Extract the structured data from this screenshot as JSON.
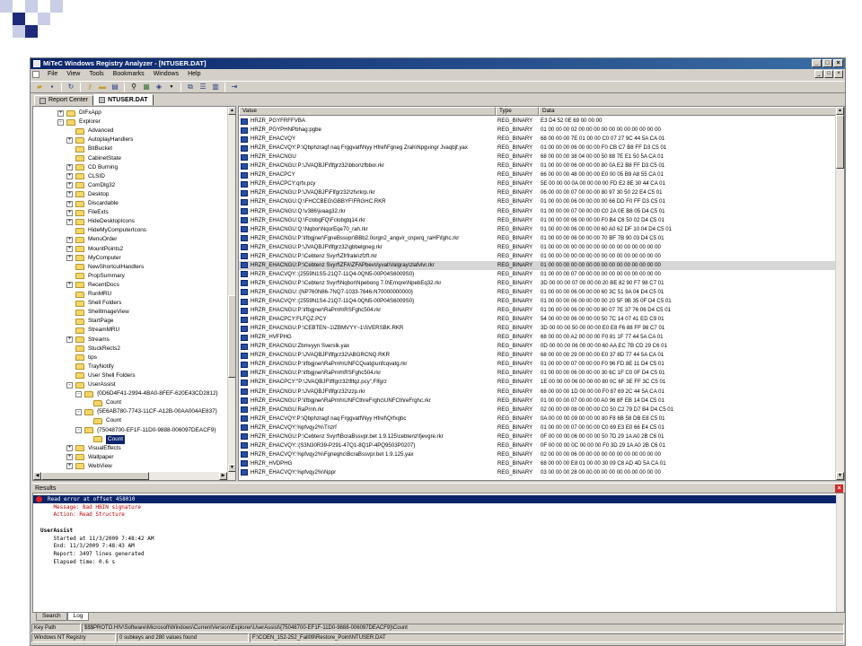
{
  "window": {
    "title": "MiTeC Windows Registry Analyzer - [NTUSER.DAT]",
    "controls": [
      "_",
      "□",
      "×"
    ],
    "mdi_controls": [
      "_",
      "□",
      "×"
    ]
  },
  "menu": [
    "File",
    "View",
    "Tools",
    "Bookmarks",
    "Windows",
    "Help"
  ],
  "tabs": [
    {
      "label": "Report Center",
      "active": false
    },
    {
      "label": "NTUSER.DAT",
      "active": true
    }
  ],
  "tree": [
    {
      "label": "DIFxApp",
      "depth": 4,
      "expand": "+"
    },
    {
      "label": "Explorer",
      "depth": 4,
      "expand": "-"
    },
    {
      "label": "Advanced",
      "depth": 5,
      "expand": ""
    },
    {
      "label": "AutoplayHandlers",
      "depth": 5,
      "expand": "+"
    },
    {
      "label": "BitBucket",
      "depth": 5,
      "expand": ""
    },
    {
      "label": "CabinetState",
      "depth": 5,
      "expand": ""
    },
    {
      "label": "CD Burning",
      "depth": 5,
      "expand": "+"
    },
    {
      "label": "CLSID",
      "depth": 5,
      "expand": "+"
    },
    {
      "label": "ComDlg32",
      "depth": 5,
      "expand": "+"
    },
    {
      "label": "Desktop",
      "depth": 5,
      "expand": "+"
    },
    {
      "label": "Discardable",
      "depth": 5,
      "expand": "+"
    },
    {
      "label": "FileExts",
      "depth": 5,
      "expand": "+"
    },
    {
      "label": "HideDesktopIcons",
      "depth": 5,
      "expand": "+"
    },
    {
      "label": "HideMyComputerIcons",
      "depth": 5,
      "expand": ""
    },
    {
      "label": "MenuOrder",
      "depth": 5,
      "expand": "+"
    },
    {
      "label": "MountPoints2",
      "depth": 5,
      "expand": "+"
    },
    {
      "label": "MyComputer",
      "depth": 5,
      "expand": "+"
    },
    {
      "label": "NewShortcutHandlers",
      "depth": 5,
      "expand": ""
    },
    {
      "label": "PropSummary",
      "depth": 5,
      "expand": ""
    },
    {
      "label": "RecentDocs",
      "depth": 5,
      "expand": "+"
    },
    {
      "label": "RunMRU",
      "depth": 5,
      "expand": ""
    },
    {
      "label": "Shell Folders",
      "depth": 5,
      "expand": ""
    },
    {
      "label": "ShellImageView",
      "depth": 5,
      "expand": ""
    },
    {
      "label": "StartPage",
      "depth": 5,
      "expand": ""
    },
    {
      "label": "StreamMRU",
      "depth": 5,
      "expand": ""
    },
    {
      "label": "Streams",
      "depth": 5,
      "expand": "+"
    },
    {
      "label": "StuckRects2",
      "depth": 5,
      "expand": ""
    },
    {
      "label": "tips",
      "depth": 5,
      "expand": ""
    },
    {
      "label": "TrayNotify",
      "depth": 5,
      "expand": ""
    },
    {
      "label": "User Shell Folders",
      "depth": 5,
      "expand": ""
    },
    {
      "label": "UserAssist",
      "depth": 5,
      "expand": "-"
    },
    {
      "label": "{0D6D4F41-2994-4BA0-8FEF-620E43CD2812}",
      "depth": 6,
      "expand": "-"
    },
    {
      "label": "Count",
      "depth": 7,
      "expand": ""
    },
    {
      "label": "{5E6AB780-7743-11CF-A12B-00AA004AE837}",
      "depth": 6,
      "expand": "-"
    },
    {
      "label": "Count",
      "depth": 7,
      "expand": ""
    },
    {
      "label": "{75048700-EF1F-11D0-9888-006097DEACF9}",
      "depth": 6,
      "expand": "-"
    },
    {
      "label": "Count",
      "depth": 7,
      "expand": "",
      "selected": true
    },
    {
      "label": "VisualEffects",
      "depth": 5,
      "expand": "+"
    },
    {
      "label": "Wallpaper",
      "depth": 5,
      "expand": "+"
    },
    {
      "label": "WebView",
      "depth": 5,
      "expand": "+"
    }
  ],
  "values_header": {
    "value": "Value",
    "type": "Type",
    "data": "Data"
  },
  "values": [
    {
      "name": "HRZR_PGYFRFFVBA",
      "type": "REG_BINARY",
      "data": "E3 D4 52 0E 69 00 00 00"
    },
    {
      "name": "HRZR_PGYPHNPbhag:pgbe",
      "type": "REG_BINARY",
      "data": "01 00 00 00 02 00 00 00 00 00 00 00 00 00 00 00"
    },
    {
      "name": "HRZR_EHACVQY",
      "type": "REG_BINARY",
      "data": "68 00 00 00 7E 01 00 00 C0 07 27 9C 44 5A CA 01"
    },
    {
      "name": "HRZR_EHACVQY:P:\\Qbphzragf naq Frggvatf\\Nyy Hfref\\Fgneg Zrah\\Npgvingr Jvaqbjf.yax",
      "type": "REG_BINARY",
      "data": "01 00 00 00 06 00 00 00 F0 CB C7 B8 FF D3 C5 01"
    },
    {
      "name": "HRZR_EHACNGU",
      "type": "REG_BINARY",
      "data": "68 00 00 00 38 04 00 00 50 88 7E E1 50 5A CA 01"
    },
    {
      "name": "HRZR_EHACNGU:P:\\JVAQBJF\\flfgrz32\\bbor\\zfbbor.rkr",
      "type": "REG_BINARY",
      "data": "01 00 00 00 06 00 00 00 80 0A E2 B8 FF D3 C5 01"
    },
    {
      "name": "HRZR_EHACPCY",
      "type": "REG_BINARY",
      "data": "66 00 00 00 48 00 00 00 E0 00 05 B9 A8 55 CA 01"
    },
    {
      "name": "HRZR_EHACPCY:qrfx.pcy",
      "type": "REG_BINARY",
      "data": "5E 00 00 00 0A 00 00 00 00 FD E2 8E 30 44 CA 01"
    },
    {
      "name": "HRZR_EHACNGU:P:\\JVAQBJF\\Flfgrz32\\zfvrkrp.rkr",
      "type": "REG_BINARY",
      "data": "06 00 00 00 07 00 00 00 80 97 30 50 22 E4 C5 01"
    },
    {
      "name": "HRZR_EHACNGU:Q:\\FHCCBEG\\GBBYF\\FRGHC.RKR",
      "type": "REG_BINARY",
      "data": "01 00 00 00 06 00 00 00 00 66 DD F0 FF D3 C5 01"
    },
    {
      "name": "HRZR_EHACNGU:Q:\\v386\\jvaag32.rkr",
      "type": "REG_BINARY",
      "data": "01 00 00 00 07 00 00 00 C0 2A 0E B8 05 D4 C5 01"
    },
    {
      "name": "HRZR_EHACNGU:Q:\\FclobgFQ\\Fclobgtq14.rkr",
      "type": "REG_BINARY",
      "data": "01 00 00 00 06 00 00 00 F0 B4 C6 50 02 D4 C5 01"
    },
    {
      "name": "HRZR_EHACNGU:Q:\\Nqbor\\NqorEqe70_rah.rkr",
      "type": "REG_BINARY",
      "data": "01 00 00 00 06 00 00 00 60 A0 62 DF 10 04 D4 C5 01"
    },
    {
      "name": "HRZR_EHACNGU:P:\\Ifbgjner\\FgneBssvpr\\BBb2.0orgn2_angvir_cnpxrq_raHF\\fghc.rkr",
      "type": "REG_BINARY",
      "data": "01 00 00 00 06 00 00 00 70 BF 7B 90 03 D4 C5 01"
    },
    {
      "name": "HRZR_EHACNGU:P:\\JVAQBJF\\flfgrz32\\gbbelgneg.rkr",
      "type": "REG_BINARY",
      "data": "01 00 00 00 00 00 00 00 00 00 00 00 00 00 00 00"
    },
    {
      "name": "HRZR_EHACNGU:P:\\Cebtenz Svyrf\\Zfrfrate\\zfzft.rkr",
      "type": "REG_BINARY",
      "data": "01 00 00 00 00 00 00 00 00 00 00 00 00 00 00 00"
    },
    {
      "name": "HRZR_EHACNGU:P:\\Cebtenz Svyrf\\ZFA\\ZFAPbevs\\yvat\\Valgray\\zlafvlvr.rkr",
      "type": "REG_BINARY",
      "data": "01 00 00 00 00 00 00 00 00 00 00 00 00 00 00 00",
      "selected": true
    },
    {
      "name": "HRZR_EHACVQY::{2559N1S5-21Q7-11Q4-0QN5-00P04S6009S0}",
      "type": "REG_BINARY",
      "data": "01 00 00 00 07 00 00 00 00 00 00 00 00 00 00 00"
    },
    {
      "name": "HRZR_EHACNGU:P:\\Cebtenz Svyrf\\Nqbor\\Npebong 7.0\\Ernqre\\NpebEq32.rkr",
      "type": "REG_BINARY",
      "data": "3D 00 00 00 07 00 00 00 20 BE 82 90 F7 98 C7 01"
    },
    {
      "name": "HRZR_EHACNGU::{NP760N86-7NQ7-1033-7646-N70000000000}",
      "type": "REG_BINARY",
      "data": "01 00 00 00 06 00 00 00 60 3C 51 9A 04 D4 C5 01"
    },
    {
      "name": "HRZR_EHACVQY::{2559N1S4-21Q7-11Q4-0QN5-00P04S6009S0}",
      "type": "REG_BINARY",
      "data": "01 00 00 00 06 00 00 00 00 20 5F 9B 35 0F D4 C5 01"
    },
    {
      "name": "HRZR_EHACNGU:P:\\Ifbgjner\\RaPrnh\\RSFghc504.rkr",
      "type": "REG_BINARY",
      "data": "01 00 00 00 06 00 00 00 80 07 7E 37 76 06 D4 C5 01"
    },
    {
      "name": "HRZR_EHACPCY:FLFQZ.PCY",
      "type": "REG_BINARY",
      "data": "54 00 00 00 06 00 00 00 50 7C 14 07 41 ED C9 01"
    },
    {
      "name": "HRZR_EHACNGU:P:\\CEBTEN~1\\ZBMVYY~1\\SVERSBK.RKR",
      "type": "REG_BINARY",
      "data": "3D 00 00 00 50 00 00 00 E0 E8 F6 88 FF 98 C7 01"
    },
    {
      "name": "HRZR_HVFPHG",
      "type": "REG_BINARY",
      "data": "68 00 00 00 A2 00 00 00 F0 81 1F 77 44 5A CA 01"
    },
    {
      "name": "HRZR_EHACNGU:Zbmvyyn Sverslk.yax",
      "type": "REG_BINARY",
      "data": "0D 00 00 00 06 00 00 00 60 AA EC 7B CD 29 C6 01"
    },
    {
      "name": "HRZR_EHACNGU:P:\\JVAQBJF\\flfgrz32\\ABGRCNQ.RKR",
      "type": "REG_BINARY",
      "data": "68 00 00 00 29 00 00 00 E0 37 8D 77 44 5A CA 01"
    },
    {
      "name": "HRZR_EHACNGU:P:\\Ifbgjner\\RaPrnh\\UNFCQvatg\\unfcqvatg.rkr",
      "type": "REG_BINARY",
      "data": "01 00 00 00 07 00 00 00 F0 96 FD 8E 11 D4 C5 01"
    },
    {
      "name": "HRZR_EHACNGU:P:\\Ifbgjner\\RaPrnh\\RSFghc504.rkr",
      "type": "REG_BINARY",
      "data": "01 00 00 00 06 00 00 00 30 6C 1F C0 0F D4 C5 01"
    },
    {
      "name": "HRZR_EHACPCY:\"P:\\JVAQBJF\\flfgrz32\\flfqz.pcy\",Flfgrz",
      "type": "REG_BINARY",
      "data": "1E 00 00 00 06 00 00 00 80 0C 6F 3E FF 3C C5 01"
    },
    {
      "name": "HRZR_EHACNGU:P:\\JVAQBJF\\flfgrz32\\zzp.rkr",
      "type": "REG_BINARY",
      "data": "68 00 00 00 1D 00 00 00 F0 87 69 2C 44 5A CA 01"
    },
    {
      "name": "HRZR_EHACNGU:P:\\Ifbgjner\\RaPrnh\\UNFCthreFrghc\\UNFCthreFrghc.rkr",
      "type": "REG_BINARY",
      "data": "01 00 00 00 07 00 00 00 A0 96 8F EB 14 D4 C5 01"
    },
    {
      "name": "HRZR_EHACNGU:RaPrnh.rkr",
      "type": "REG_BINARY",
      "data": "02 00 00 00 08 00 00 00 C0 50 C2 79 D7 B4 D4 C5 01"
    },
    {
      "name": "HRZR_EHACVQY:P:\\Qbphzragf naq Frggvatf\\Nyy Hfref\\Qrfxgbc",
      "type": "REG_BINARY",
      "data": "0A 00 00 00 09 00 00 00 80 F8 6B 58 DB E8 C5 01"
    },
    {
      "name": "HRZR_EHACVQY:%pfvqy2%\\Tnzrf",
      "type": "REG_BINARY",
      "data": "01 00 00 00 07 00 00 00 C0 69 E3 E0 66 E4 C5 01"
    },
    {
      "name": "HRZR_EHACNGU:P:\\Cebtenz Svyrf\\BcraBssvpr.bet 1.9.125\\cebtenz\\fjevgre.rkr",
      "type": "REG_BINARY",
      "data": "0F 00 00 00 06 00 00 00 50 7D 29 1A A0 2B C6 01"
    },
    {
      "name": "HRZR_EHACVQY::{S3N30R39-P291-47Q1-8Q1P-4PQ9503P0207}",
      "type": "REG_BINARY",
      "data": "0F 00 00 00 0C 00 00 00 F0 3D 29 1A A0 2B C6 01"
    },
    {
      "name": "HRZR_EHACVQY:%pfvqy2%\\Fgneghc\\BcraBssvpr.bet 1.9.125.yax",
      "type": "REG_BINARY",
      "data": "02 00 00 00 06 00 00 00 00 00 00 00 00 00 00 00"
    },
    {
      "name": "HRZR_HVDPHG",
      "type": "REG_BINARY",
      "data": "68 00 00 00 E8 01 00 00 30 09 C8 AD 4D 5A CA 01"
    },
    {
      "name": "HRZR_EHACVQY:%pfvqy2%\\Nppr",
      "type": "REG_BINARY",
      "data": "03 00 00 00 28 00 00 00 00 00 00 00 00 00 00 00"
    }
  ],
  "results": {
    "header": "Results",
    "lines": [
      {
        "text": "Read error at offset 458010",
        "style": "err"
      },
      {
        "text": "    Message: Bad HBIN signature",
        "style": "red"
      },
      {
        "text": "    Action: Read Structure",
        "style": "red"
      },
      {
        "text": "",
        "style": ""
      },
      {
        "text": "UserAssist",
        "style": "bold"
      },
      {
        "text": "    Started at 11/3/2009 7:48:42 AM",
        "style": ""
      },
      {
        "text": "    End: 11/3/2009 7:48:43 AM",
        "style": ""
      },
      {
        "text": "    Report: 3497 lines generated",
        "style": ""
      },
      {
        "text": "    Elapsed time: 0.6 s",
        "style": ""
      }
    ]
  },
  "bottom_tabs": [
    {
      "label": "Search",
      "active": false
    },
    {
      "label": "Log",
      "active": true
    }
  ],
  "status": {
    "key_path_label": "Key Path",
    "key_path_value": "$$$PROTO.HIV\\Software\\Microsoft\\Windows\\CurrentVersion\\Explorer\\UserAssist\\{75048700-EF1F-11D0-9888-006097DEACF9}\\Count",
    "registry_type": "Windows NT Registry",
    "counts": "0 subkeys and 280 values found",
    "file_path": "F:\\COEN_152-252_Fall09\\Restore_Point\\NTUSER.DAT"
  },
  "colors": {
    "titlebar": "#0a246a",
    "selection": "#0a246a",
    "deco_dark": "#1f2a7a",
    "deco_light": "#c9cde6",
    "error_text": "#c00000"
  },
  "icons": {
    "folder": "folder-icon",
    "binary_value": "binary-value-icon",
    "error": "error-icon"
  }
}
